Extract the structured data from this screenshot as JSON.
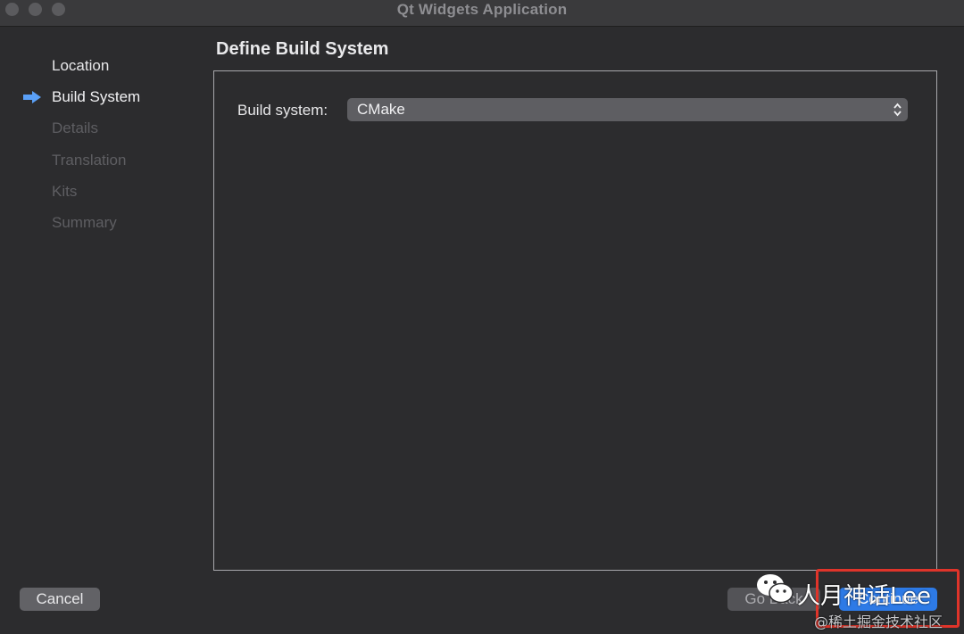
{
  "window": {
    "title": "Qt Widgets Application"
  },
  "steps": [
    {
      "label": "Location",
      "state": "done"
    },
    {
      "label": "Build System",
      "state": "current"
    },
    {
      "label": "Details",
      "state": "upcoming"
    },
    {
      "label": "Translation",
      "state": "upcoming"
    },
    {
      "label": "Kits",
      "state": "upcoming"
    },
    {
      "label": "Summary",
      "state": "upcoming"
    }
  ],
  "page": {
    "title": "Define Build System",
    "build_system_label": "Build system:",
    "build_system_value": "CMake"
  },
  "buttons": {
    "cancel": "Cancel",
    "go_back": "Go Back",
    "continue": "Continue"
  },
  "watermark": {
    "text": "人月神话Lee",
    "sub": "@稀土掘金技术社区"
  },
  "colors": {
    "accent": "#2d7ae6",
    "highlight": "#e0342a",
    "current_step_arrow": "#5aa0f7"
  },
  "icons": {
    "current_step": "arrow-right-icon",
    "select": "up-down-chevron-icon",
    "watermark": "wechat-icon"
  }
}
